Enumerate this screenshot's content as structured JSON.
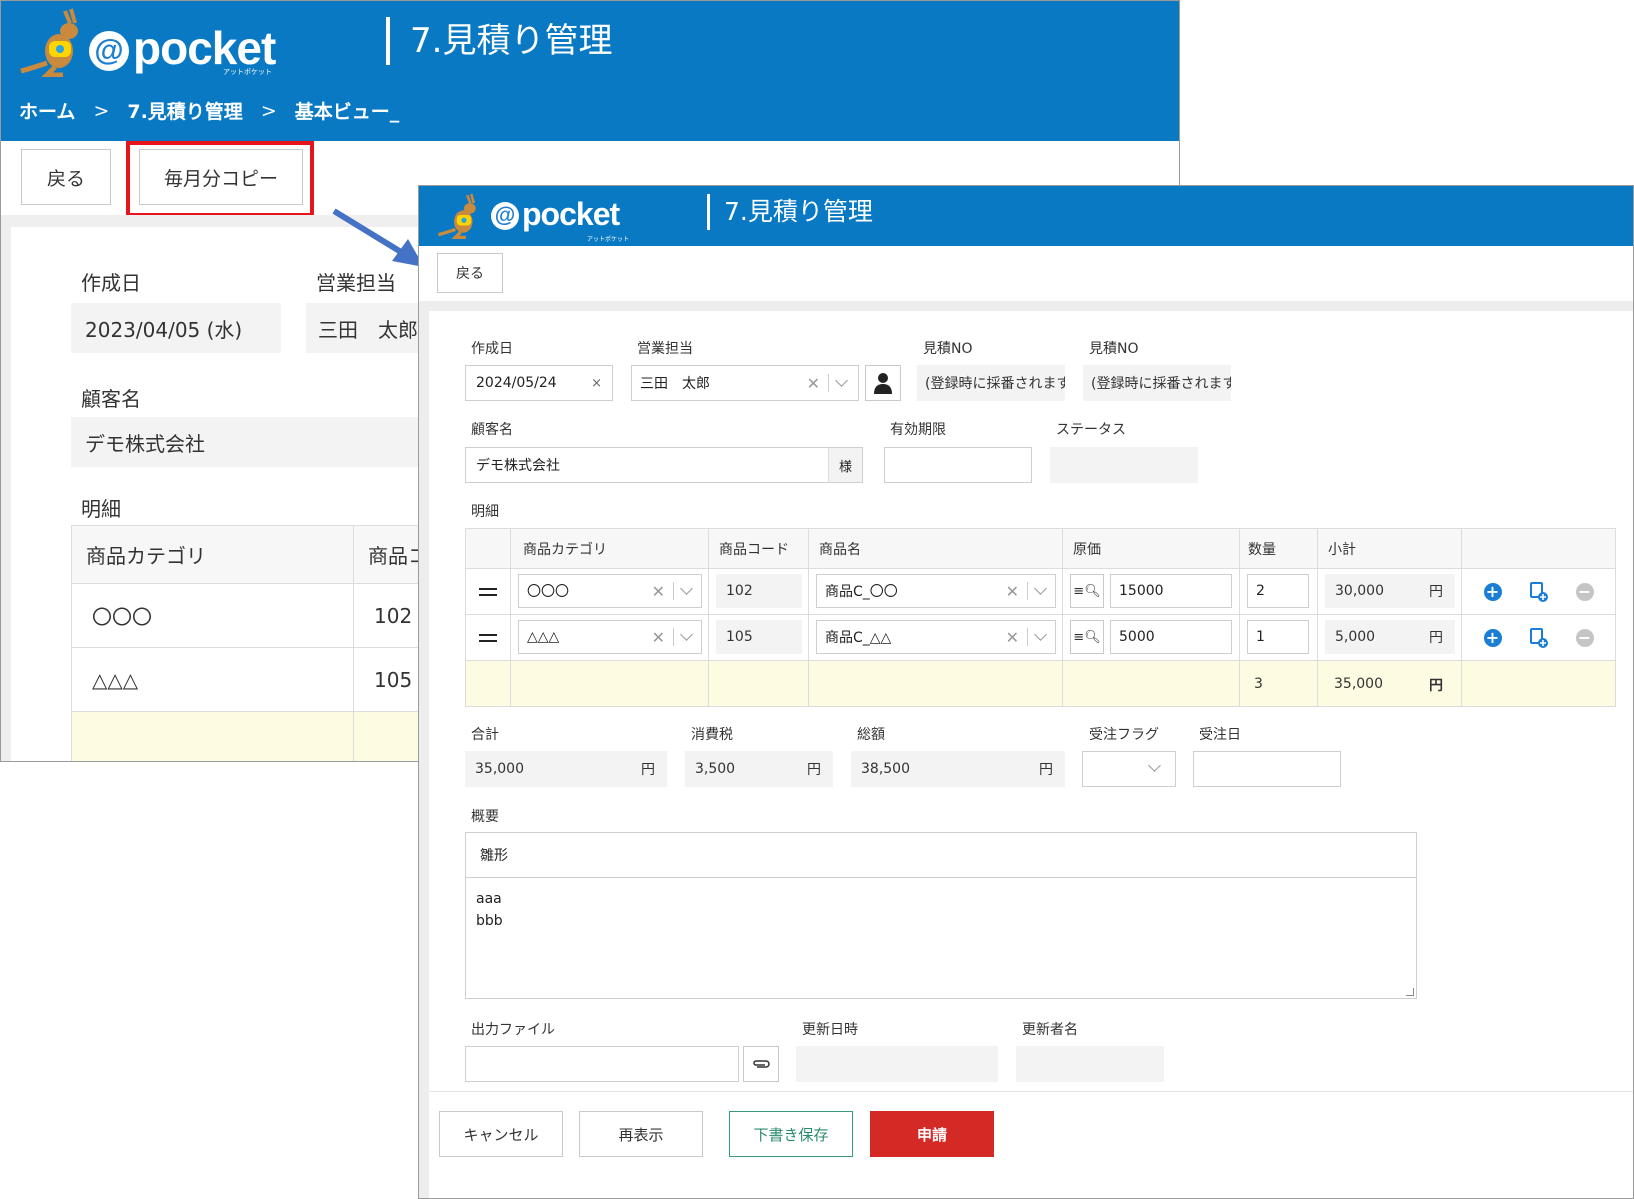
{
  "back": {
    "brand": "pocket",
    "brand_at": "@",
    "brand_sub": "アットポケット",
    "title": "7.見積り管理",
    "breadcrumbs": [
      "ホーム",
      "7.見積り管理",
      "基本ビュー_"
    ],
    "breadcrumb_sep": ">",
    "back_button": "戻る",
    "monthly_copy_button": "毎月分コピー",
    "created_label": "作成日",
    "created_value": "2023/04/05 (水)",
    "sales_label": "営業担当",
    "sales_value": "三田　太郎",
    "customer_label": "顧客名",
    "customer_value": "デモ株式会社",
    "detail_label": "明細",
    "columns": [
      "商品カテゴリ",
      "商品コ"
    ],
    "rows": [
      {
        "category": "〇〇〇",
        "code": "102"
      },
      {
        "category": "△△△",
        "code": "105"
      }
    ]
  },
  "highlight_color": "#e8141b",
  "arrow_color": "#4472c4",
  "front": {
    "brand": "pocket",
    "brand_at": "@",
    "brand_sub": "アットポケット",
    "title": "7.見積り管理",
    "back_button": "戻る",
    "created_label": "作成日",
    "created_value": "2024/05/24",
    "sales_label": "営業担当",
    "sales_value": "三田　太郎",
    "quote_no_label_1": "見積NO",
    "quote_no_value_1": "(登録時に採番されます",
    "quote_no_label_2": "見積NO",
    "quote_no_value_2": "(登録時に採番されます",
    "customer_label": "顧客名",
    "customer_value": "デモ株式会社",
    "customer_suffix": "様",
    "expiry_label": "有効期限",
    "status_label": "ステータス",
    "detail_label": "明細",
    "columns": [
      "商品カテゴリ",
      "商品コード",
      "商品名",
      "原価",
      "数量",
      "小計"
    ],
    "rows": [
      {
        "category": "〇〇〇",
        "code": "102",
        "name": "商品C_〇〇",
        "cost": "15000",
        "qty": "2",
        "subtotal": "30,000",
        "unit": "円"
      },
      {
        "category": "△△△",
        "code": "105",
        "name": "商品C_△△",
        "cost": "5000",
        "qty": "1",
        "subtotal": "5,000",
        "unit": "円"
      }
    ],
    "total_row": {
      "qty": "3",
      "subtotal": "35,000",
      "unit": "円"
    },
    "sum_label": "合計",
    "sum_value": "35,000",
    "tax_label": "消費税",
    "tax_value": "3,500",
    "gross_label": "総額",
    "gross_value": "38,500",
    "yen": "円",
    "order_flag_label": "受注フラグ",
    "order_date_label": "受注日",
    "summary_label": "概要",
    "summary_title": "雛形",
    "summary_body_line1": "aaa",
    "summary_body_line2": "bbb",
    "output_file_label": "出力ファイル",
    "updated_at_label": "更新日時",
    "updated_by_label": "更新者名",
    "cancel_button": "キャンセル",
    "redisplay_button": "再表示",
    "draft_save_button": "下書き保存",
    "apply_button": "申請"
  },
  "colors": {
    "header_blue": "#0a79c4",
    "apply_red": "#d42a26",
    "draft_green": "#3a9a7c",
    "total_row_bg": "#fdfce3"
  },
  "icons": [
    "kangaroo-logo-icon",
    "clear-x-icon",
    "chevron-down-icon",
    "person-icon",
    "drag-handle-icon",
    "search-list-icon",
    "add-circle-icon",
    "copy-row-icon",
    "remove-circle-icon",
    "paperclip-icon",
    "calendar-clear-icon"
  ]
}
